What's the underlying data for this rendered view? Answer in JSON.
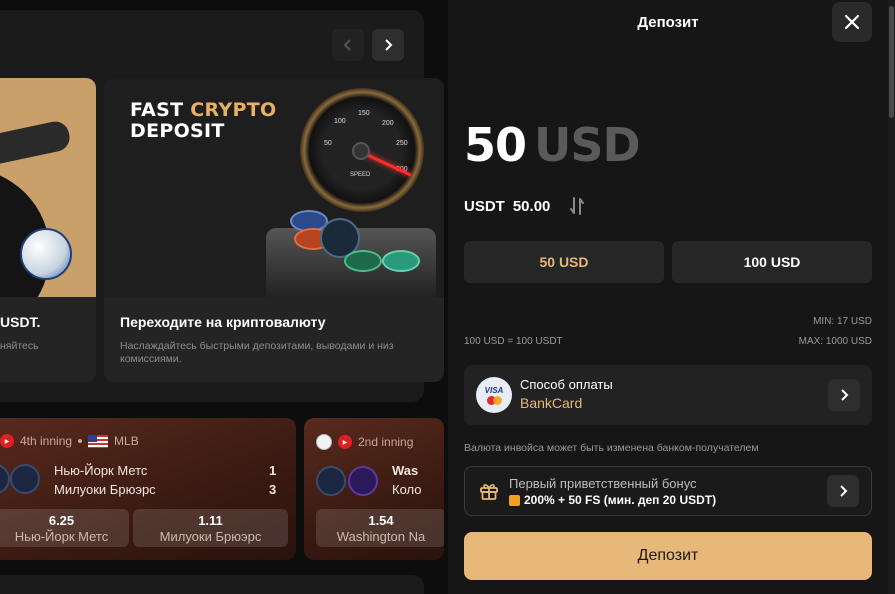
{
  "promo": {
    "card1": {
      "title": "USDT.",
      "desc": "няйтесь"
    },
    "card2": {
      "headline_1": "FAST",
      "headline_accent": "CRYPTO",
      "headline_2": "DEPOSIT",
      "gauge_ticks": [
        "100",
        "150",
        "200",
        "250",
        "300",
        "50"
      ],
      "gauge_label": "SPEED",
      "title": "Переходите на криптовалюту",
      "desc": "Наслаждайтесь быстрыми депозитами, выводами и низ\nкомиссиями."
    }
  },
  "matches": [
    {
      "status": "4th inning",
      "league": "MLB",
      "team1": "Нью-Йорк Метс",
      "team2": "Милуоки Брюэрс",
      "score1": "1",
      "score2": "3",
      "odds": [
        {
          "value": "6.25",
          "name": "Нью-Йорк Метс"
        },
        {
          "value": "1.11",
          "name": "Милуоки Брюэрс"
        }
      ]
    },
    {
      "status": "2nd inning",
      "team1": "Was",
      "team2": "Коло",
      "odds": [
        {
          "value": "1.54",
          "name": "Washington Na"
        }
      ]
    }
  ],
  "drawer": {
    "title": "Депозит",
    "amount_value": "50",
    "amount_currency": "USD",
    "crypto_currency": "USDT",
    "crypto_amount": "50.00",
    "presets": [
      "50 USD",
      "100 USD"
    ],
    "limit_min": "MIN: 17 USD",
    "limit_max": "MAX: 1000 USD",
    "rate": "100 USD = 100 USDT",
    "payment": {
      "label": "Способ оплаты",
      "value": "BankCard",
      "logo_text": "VISA"
    },
    "notice": "Валюта инвойса может быть изменена банком-получателем",
    "bonus": {
      "label": "Первый приветственный бонус",
      "value": "200% + 50 FS (мин. деп 20 USDT)"
    },
    "submit_label": "Депозит"
  },
  "colors": {
    "accent": "#e8b878",
    "background": "#161616",
    "panel": "#222222"
  }
}
